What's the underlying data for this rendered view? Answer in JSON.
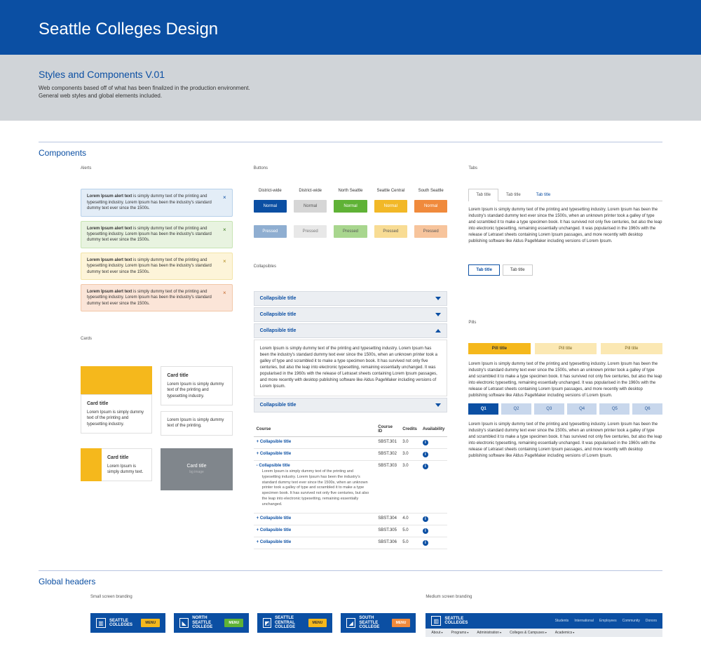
{
  "banner": {
    "title": "Seattle Colleges Design"
  },
  "intro": {
    "heading": "Styles and Components V.01",
    "line1": "Web components based off of what has been finalized in the production environment.",
    "line2": "General web styles and global elements included."
  },
  "sections": {
    "components": "Components",
    "global_headers": "Global headers"
  },
  "labels": {
    "alerts": "Alerts",
    "cards": "Cards",
    "buttons": "Buttons",
    "collapsibles": "Collapsibles",
    "tabs": "Tabs",
    "pills": "Pills",
    "small_branding": "Small screen branding",
    "medium_branding": "Medium screen branding"
  },
  "alerts": {
    "bold": "Lorem Ipsum alert text",
    "rest": " is simply dummy text of the printing and typesetting industry. Lorem Ipsum has been the industry's standard dummy text ever since the 1500s.",
    "close": "×"
  },
  "cards": {
    "title": "Card title",
    "text_long": "Lorem Ipsum is simply dummy text of the printing and typesetting industry.",
    "text_short": "Lorem Ipsum is simply dummy text of the printing.",
    "text_tiny": "Lorem Ipsum is simply dummy text.",
    "bg_image": "bg image"
  },
  "buttons": {
    "cols": [
      "District-wide",
      "District-wide",
      "North Seattle",
      "Seattle Central",
      "South Seattle"
    ],
    "normal": "Normal",
    "pressed": "Pressed"
  },
  "collapsibles": {
    "title": "Collapsible title",
    "body": "Lorem Ipsum is simply dummy text of the printing and typesetting industry. Lorem Ipsum has been the industry's standard dummy text ever since the 1500s, when an unknown printer took a galley of type and scrambled it to make a type specimen book. It has survived not only five centuries, but also the leap into electronic typesetting, remaining essentially unchanged. It was popularised in the 1960s with the release of Letraset sheets containing Lorem Ipsum passages, and more recently with desktop publishing software like Aldus PageMaker including versions of Lorem Ipsum."
  },
  "table": {
    "headers": [
      "Course",
      "Course ID",
      "Credits",
      "Availability"
    ],
    "rows": [
      {
        "course": "Collapsible title",
        "id": "SBST.301",
        "credits": "3.0",
        "open": false
      },
      {
        "course": "Collapsible title",
        "id": "SBST.302",
        "credits": "3.0",
        "open": false
      },
      {
        "course": "Collapsible title",
        "id": "SBST.303",
        "credits": "3.0",
        "open": true
      },
      {
        "course": "Collapsible title",
        "id": "SBST.304",
        "credits": "4.0",
        "open": false
      },
      {
        "course": "Collapsible title",
        "id": "SBST.305",
        "credits": "5.0",
        "open": false
      },
      {
        "course": "Collapsible title",
        "id": "SBST.306",
        "credits": "5.0",
        "open": false
      }
    ],
    "desc": "Lorem Ipsum is simply dummy text of the printing and typesetting industry. Lorem Ipsum has been the industry's standard dummy text ever since the 1500s, when an unknown printer took a galley of type and scrambled it to make a type specimen book. It has survived not only five centuries, but also the leap into electronic typesetting, remaining essentially unchanged.",
    "info": "i"
  },
  "tabs": {
    "tab_title": "Tab title",
    "body": "Lorem Ipsum is simply dummy text of the printing and typesetting industry. Lorem Ipsum has been the industry's standard dummy text ever since the 1500s, when an unknown printer took a galley of type and scrambled it to make a type specimen book. It has survived not only five centuries, but also the leap into electronic typesetting, remaining essentially unchanged. It was popularised in the 1960s with the release of Letraset sheets containing Lorem Ipsum passages, and more recently with desktop publishing software like Aldus PageMaker including versions of Lorem Ipsum."
  },
  "pills": {
    "pill_title": "Pill title",
    "q": [
      "Q1",
      "Q2",
      "Q3",
      "Q4",
      "Q5",
      "Q6"
    ],
    "body1": "Lorem Ipsum is simply dummy text of the printing and typesetting industry. Lorem Ipsum has been the industry's standard dummy text ever since the 1500s, when an unknown printer took a galley of type and scrambled it to make a type specimen book. It has survived not only five centuries, but also the leap into electronic typesetting, remaining essentially unchanged. It was popularised in the 1960s with the release of Letraset sheets containing Lorem Ipsum passages, and more recently with desktop publishing software like Aldus PageMaker including versions of Lorem Ipsum.",
    "body2": "Lorem Ipsum is simply dummy text of the printing and typesetting industry. Lorem Ipsum has been the industry's standard dummy text ever since the 1500s, when an unknown printer took a galley of type and scrambled it to make a type specimen book. It has survived not only five centuries, but also the leap into electronic typesetting, remaining essentially unchanged. It was popularised in the 1960s with the release of Letraset sheets containing Lorem Ipsum passages, and more recently with desktop publishing software like Aldus PageMaker including versions of Lorem Ipsum."
  },
  "headers": {
    "menu": "MENU",
    "brands": [
      {
        "line1": "SEATTLE",
        "line2": "COLLEGES"
      },
      {
        "line1": "NORTH SEATTLE",
        "line2": "COLLEGE"
      },
      {
        "line1": "SEATTLE CENTRAL",
        "line2": "COLLEGE"
      },
      {
        "line1": "SOUTH SEATTLE",
        "line2": "COLLEGE"
      }
    ],
    "top_links": [
      "Students",
      "International",
      "Employees",
      "Community",
      "Donors"
    ],
    "nav": [
      "About",
      "Programs",
      "Administration",
      "Colleges & Campuses",
      "Academics"
    ]
  }
}
